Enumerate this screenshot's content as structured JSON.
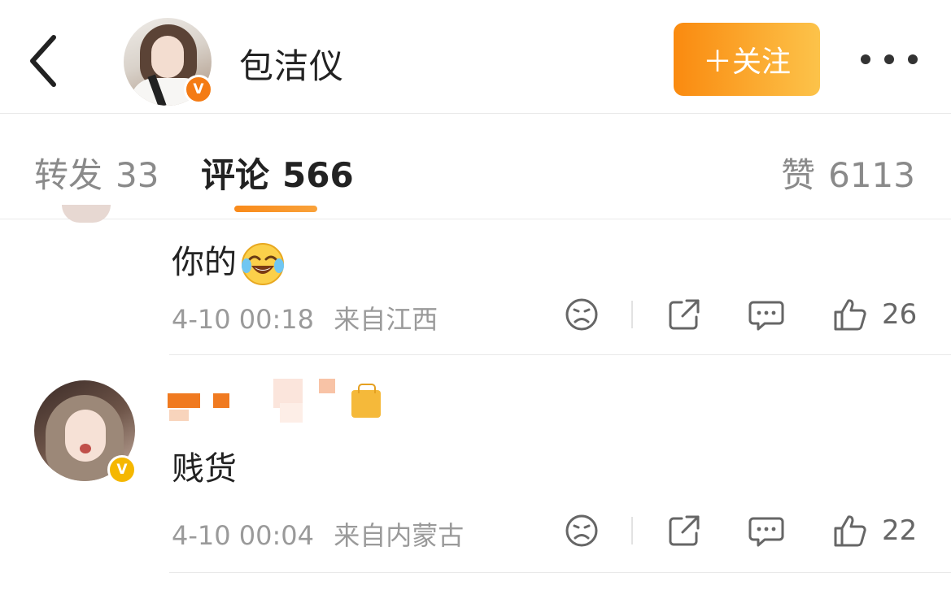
{
  "header": {
    "username": "包洁仪",
    "follow_label": "＋关注"
  },
  "tabs": [
    {
      "label": "转发",
      "count": "33"
    },
    {
      "label": "评论",
      "count": "566"
    },
    {
      "label": "赞",
      "count": "6113"
    }
  ],
  "comments": [
    {
      "text": "你的",
      "time": "4-10 00:18",
      "location": "来自江西",
      "likes": "26"
    },
    {
      "text": "贱货",
      "time": "4-10 00:04",
      "location": "来自内蒙古",
      "likes": "22"
    }
  ],
  "colors": {
    "accent": "#f98a1a",
    "follow_gradient_start": "#fa8a0f",
    "follow_gradient_end": "#fcc34a",
    "verified_orange": "#f47b14",
    "verified_gold": "#f5b700"
  },
  "icons": [
    "back-arrow-icon",
    "verified-icon",
    "more-icon",
    "dislike-face-icon",
    "share-icon",
    "comment-icon",
    "thumbs-up-icon",
    "laugh-cry-emoji"
  ]
}
